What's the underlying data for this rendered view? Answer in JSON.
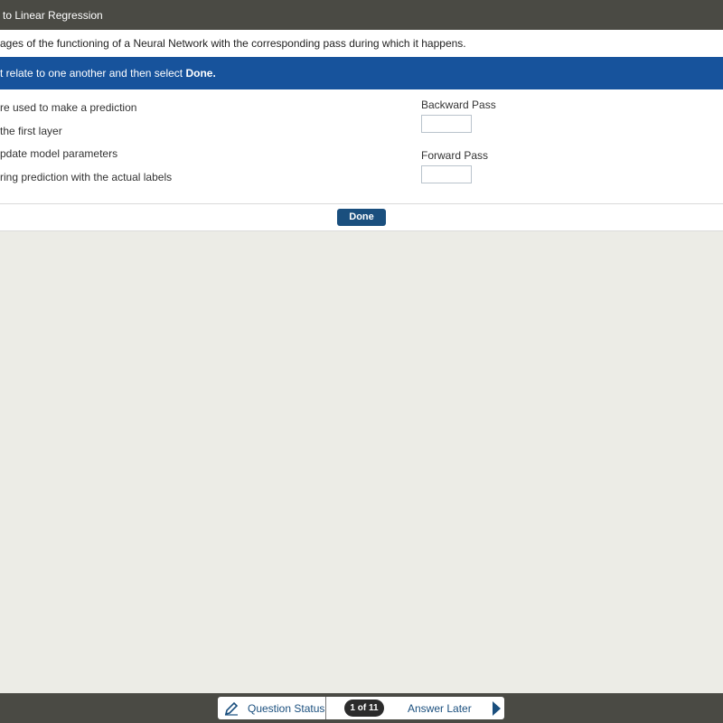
{
  "window": {
    "title": "to Linear Regression"
  },
  "question": {
    "prompt": "ages of the functioning of a Neural Network with the corresponding pass during which it happens.",
    "instruction_prefix": "t relate to one another and then select ",
    "instruction_bold": "Done."
  },
  "statements": [
    "re used to make a prediction",
    "the first layer",
    "pdate model parameters",
    "ring prediction with the actual labels"
  ],
  "targets": [
    {
      "label": "Backward Pass",
      "value": ""
    },
    {
      "label": "Forward Pass",
      "value": ""
    }
  ],
  "actions": {
    "done_label": "Done"
  },
  "footer": {
    "question_status_label": "Question Status",
    "counter": "1 of 11",
    "answer_later_label": "Answer Later"
  },
  "icons": {
    "question_status": "pencil-icon",
    "next": "right-arrow-icon"
  },
  "colors": {
    "title_bar": "#4a4a44",
    "instruction_bar": "#17539c",
    "done_button": "#1a4f7e",
    "accent_text": "#1a4f7e",
    "workspace": "#ecece6"
  }
}
